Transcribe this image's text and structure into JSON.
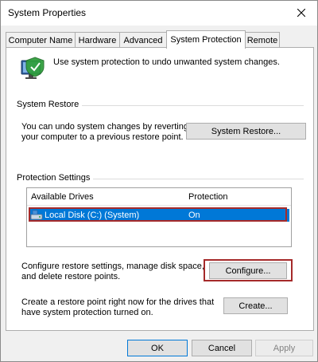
{
  "window": {
    "title": "System Properties"
  },
  "tabs": [
    {
      "label": "Computer Name",
      "active": false
    },
    {
      "label": "Hardware",
      "active": false
    },
    {
      "label": "Advanced",
      "active": false
    },
    {
      "label": "System Protection",
      "active": true
    },
    {
      "label": "Remote",
      "active": false
    }
  ],
  "intro": {
    "text": "Use system protection to undo unwanted system changes."
  },
  "system_restore": {
    "group_label": "System Restore",
    "description_line1": "You can undo system changes by reverting",
    "description_line2": "your computer to a previous restore point.",
    "button_label": "System Restore..."
  },
  "protection": {
    "group_label": "Protection Settings",
    "columns": [
      "Available Drives",
      "Protection"
    ],
    "drives": [
      {
        "name": "Local Disk (C:) (System)",
        "protection": "On",
        "selected": true
      }
    ],
    "configure_text_line1": "Configure restore settings, manage disk space,",
    "configure_text_line2": "and delete restore points.",
    "configure_button": "Configure...",
    "create_text_line1": "Create a restore point right now for the drives that",
    "create_text_line2": "have system protection turned on.",
    "create_button": "Create..."
  },
  "footer": {
    "ok": "OK",
    "cancel": "Cancel",
    "apply": "Apply"
  },
  "colors": {
    "selection": "#0078d7",
    "highlight_box": "#a52a2a",
    "window_bg": "#f0f0f0"
  },
  "icons": {
    "close": "close-icon",
    "system_protection": "system-protection-icon",
    "drive": "drive-icon"
  }
}
